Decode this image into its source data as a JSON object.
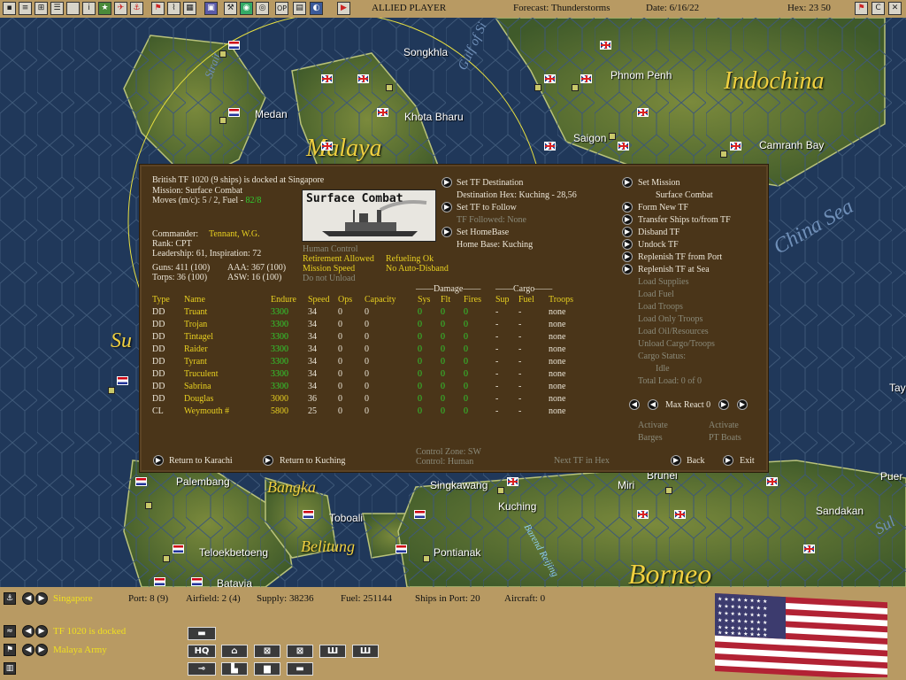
{
  "topbar": {
    "player": "ALLIED PLAYER",
    "forecast": "Forecast: Thunderstorms",
    "date": "Date: 6/16/22",
    "hex": "Hex: 23  50",
    "icons": [
      "document-icon",
      "report-icon",
      "unit-icon",
      "list-icon",
      "info-icon",
      "star-icon",
      "plane-icon",
      "ship-icon",
      "flag-icon",
      "terrain-icon",
      "map-icon",
      "tool-icon",
      "globe-icon",
      "target-icon",
      "op-icon",
      "chart-icon",
      "camera-icon",
      "play-icon"
    ],
    "op_label": "OP",
    "right_buttons": [
      "flag-icon",
      "C",
      "X"
    ]
  },
  "map": {
    "cities": [
      "Songkhla",
      "Phnom Penh",
      "Medan",
      "Khota Bharu",
      "Saigon",
      "Camranh Bay",
      "Palembang",
      "Singkawang",
      "Kuching",
      "Miri",
      "Brunei",
      "Toboali",
      "Pontianak",
      "Teloekbetoeng",
      "Batavia",
      "Sandakan",
      "Puer",
      "Tay"
    ],
    "regions": [
      "Indochina",
      "Malaya",
      "Borneo",
      "Bangka",
      "Belitung",
      "Su"
    ],
    "seas": [
      "China Sea",
      "Gulf of Si",
      "Strait",
      "Barend Reijing",
      "Sul"
    ]
  },
  "dialog": {
    "header": {
      "line1": "British TF 1020 (9 ships) is docked at Singapore",
      "line2": "Mission: Surface Combat",
      "moves_label": "Moves (m/c): 5 / 2, Fuel - ",
      "fuel": "82/8",
      "commander_label": "Commander:",
      "commander": "Tennant, W.G.",
      "rank": "Rank: CPT",
      "leadership": "Leadership: 61, Inspiration: 72",
      "guns": "Guns: 411 (100)",
      "aaa": "AAA: 367 (100)",
      "torps": "Torps: 36 (100)",
      "asw": "ASW: 16 (100)"
    },
    "image_label": "Surface Combat",
    "status": {
      "human_control": "Human Control",
      "retirement": "Retirement Allowed",
      "refueling": "Refueling Ok",
      "mission_speed": "Mission Speed",
      "auto_disband": "No Auto-Disband",
      "unload": "Do not Unload"
    },
    "mid": {
      "set_dest": "Set TF Destination",
      "dest_hex": "Destination Hex: Kuching - 28,56",
      "set_follow": "Set TF to Follow",
      "followed": "TF Followed: None",
      "set_home": "Set HomeBase",
      "home_base": "Home Base: Kuching"
    },
    "right": {
      "set_mission": "Set Mission",
      "mission_value": "Surface Combat",
      "form_new": "Form New TF",
      "transfer": "Transfer Ships to/from TF",
      "disband": "Disband TF",
      "undock": "Undock TF",
      "replenish_port": "Replenish TF from Port",
      "replenish_sea": "Replenish TF at Sea",
      "load_supplies": "Load Supplies",
      "load_fuel": "Load Fuel",
      "load_troops": "Load Troops",
      "load_only_troops": "Load Only Troops",
      "load_oil": "Load Oil/Resources",
      "unload_cargo": "Unload Cargo/Troops",
      "cargo_status": "Cargo Status:",
      "cargo_value": "Idle",
      "total_load": "Total Load: 0 of 0",
      "max_react": "Max React  0",
      "activate_barges_1": "Activate",
      "activate_barges_2": "Barges",
      "activate_pt_1": "Activate",
      "activate_pt_2": "PT Boats"
    },
    "table": {
      "group_damage": "Damage",
      "group_cargo": "Cargo",
      "headers": [
        "Type",
        "Name",
        "Endure",
        "Speed",
        "Ops",
        "Capacity",
        "Sys",
        "Flt",
        "Fires",
        "Sup",
        "Fuel",
        "Troops"
      ],
      "rows": [
        [
          "DD",
          "Truant",
          "3300",
          "34",
          "0",
          "0",
          "0",
          "0",
          "0",
          "-",
          "-",
          "none"
        ],
        [
          "DD",
          "Trojan",
          "3300",
          "34",
          "0",
          "0",
          "0",
          "0",
          "0",
          "-",
          "-",
          "none"
        ],
        [
          "DD",
          "Tintagel",
          "3300",
          "34",
          "0",
          "0",
          "0",
          "0",
          "0",
          "-",
          "-",
          "none"
        ],
        [
          "DD",
          "Raider",
          "3300",
          "34",
          "0",
          "0",
          "0",
          "0",
          "0",
          "-",
          "-",
          "none"
        ],
        [
          "DD",
          "Tyrant",
          "3300",
          "34",
          "0",
          "0",
          "0",
          "0",
          "0",
          "-",
          "-",
          "none"
        ],
        [
          "DD",
          "Truculent",
          "3300",
          "34",
          "0",
          "0",
          "0",
          "0",
          "0",
          "-",
          "-",
          "none"
        ],
        [
          "DD",
          "Sabrina",
          "3300",
          "34",
          "0",
          "0",
          "0",
          "0",
          "0",
          "-",
          "-",
          "none"
        ],
        [
          "DD",
          "Douglas",
          "3000",
          "36",
          "0",
          "0",
          "0",
          "0",
          "0",
          "-",
          "-",
          "none"
        ],
        [
          "CL",
          "Weymouth #",
          "5800",
          "25",
          "0",
          "0",
          "0",
          "0",
          "0",
          "-",
          "-",
          "none"
        ]
      ]
    },
    "footer": {
      "return_karachi": "Return to Karachi",
      "return_kuching": "Return to Kuching",
      "control_zone": "Control Zone: SW",
      "control": "Control:    Human",
      "next_tf": "Next TF in Hex",
      "back": "Back",
      "exit": "Exit"
    }
  },
  "bottom": {
    "location": "Singapore",
    "port": "Port: 8 (9)",
    "airfield": "Airfield: 2 (4)",
    "supply": "Supply: 38236",
    "fuel": "Fuel: 251144",
    "ships_in_port": "Ships in Port: 20",
    "aircraft": "Aircraft: 0",
    "tf_status": "TF 1020 is docked",
    "army": "Malaya Army",
    "hq_label": "HQ"
  },
  "colors": {
    "accent_yellow": "#e8d020",
    "green": "#30d030",
    "dialog_bg": "#4a3519",
    "bar_bg": "#b89a63"
  }
}
